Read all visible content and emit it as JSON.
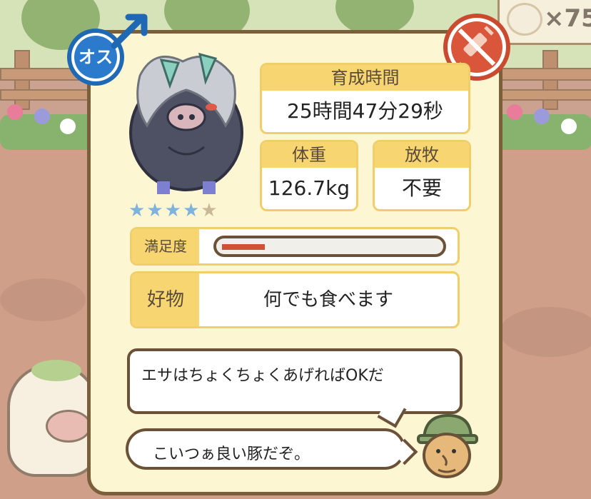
{
  "counter": {
    "icon": "pig-face-icon",
    "text": "×75"
  },
  "card": {
    "gender": {
      "label": "オス",
      "icon": "male-symbol-icon",
      "color": "#1f68b3"
    },
    "vaccine_icon": "no-vaccine-syringe-icon",
    "pig_icon": "gray-unicorn-pig-icon",
    "rating": {
      "value": 4,
      "max": 5
    },
    "breeding_time": {
      "label": "育成時間",
      "value": "25時間47分29秒"
    },
    "weight": {
      "label": "体重",
      "value": "126.7kg"
    },
    "grazing": {
      "label": "放牧",
      "value": "不要"
    },
    "satisfaction": {
      "label": "満足度",
      "level": 0.2,
      "fill_color": "#d0503a"
    },
    "favorite": {
      "label": "好物",
      "value": "何でも食べます"
    },
    "farmer_speech": "エサはちょくちょくあげればOKだ",
    "pig_speech": "こいつぁ良い豚だぞ。",
    "farmer_icon": "farmer-face-icon"
  },
  "colors": {
    "card_bg": "#fdf6d3",
    "header_yellow": "#f7d671",
    "frame_brown": "#7b5f3b"
  }
}
